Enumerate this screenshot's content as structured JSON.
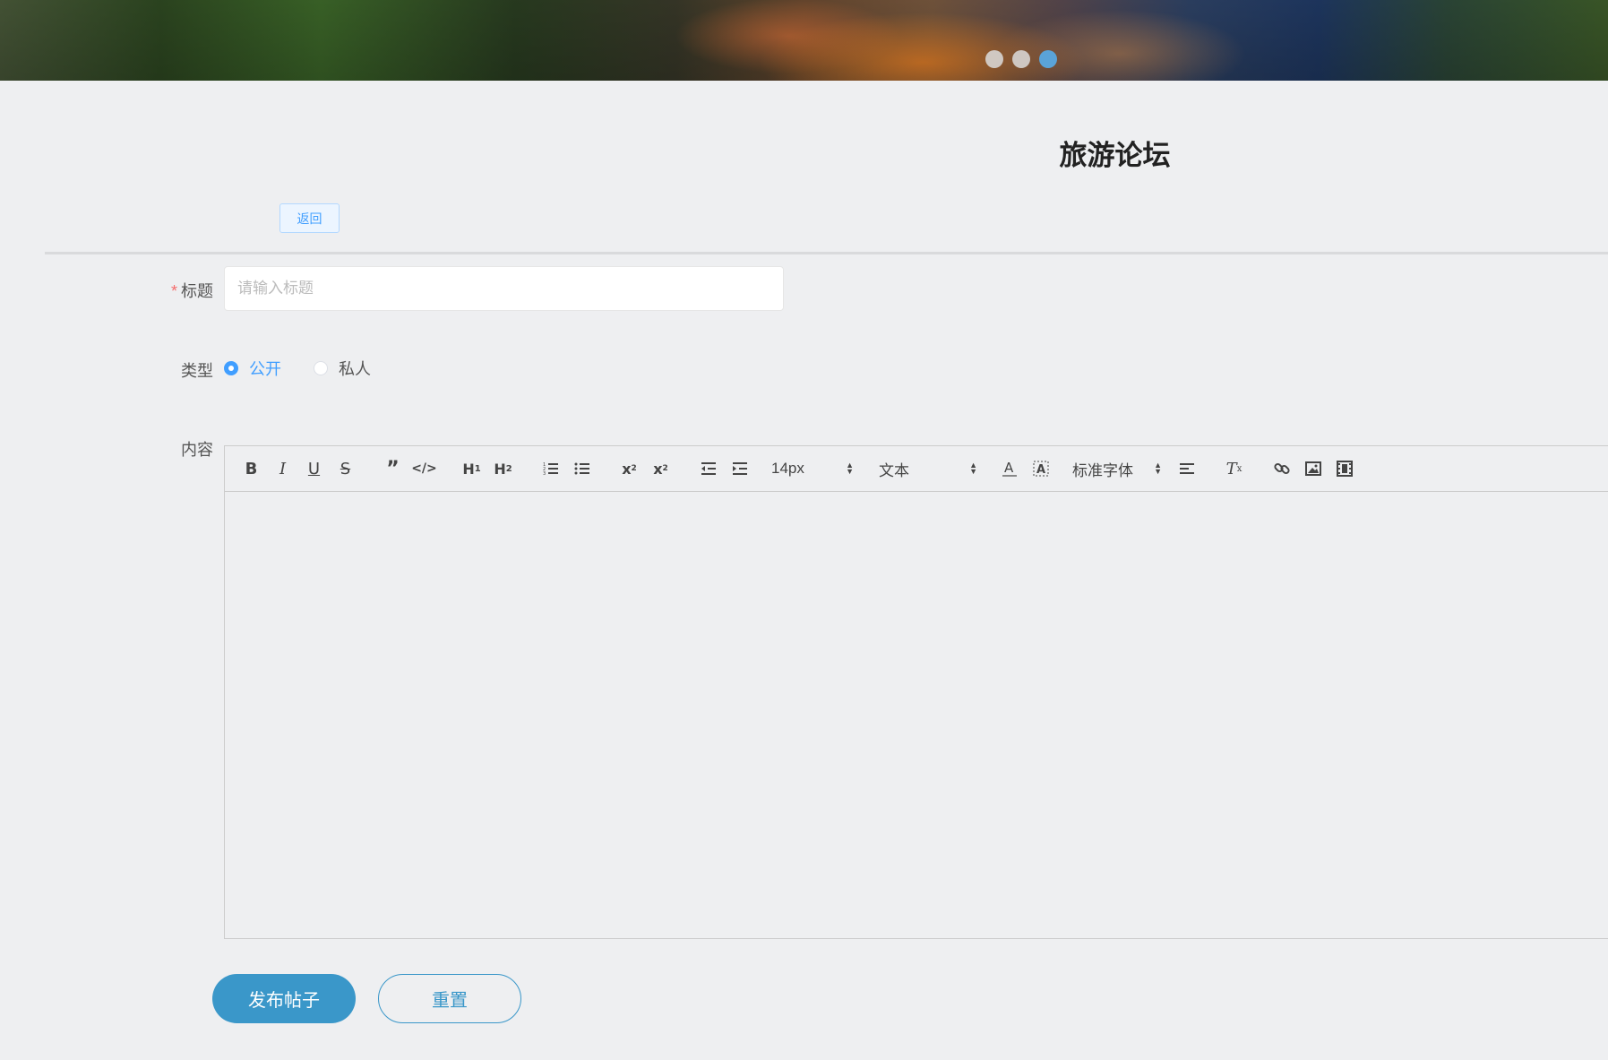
{
  "banner": {
    "carousel_dots": 3,
    "active_dot": 3
  },
  "header": {
    "title": "旅游论坛",
    "back_label": "返回"
  },
  "form": {
    "title_field": {
      "label": "标题",
      "required_mark": "*",
      "placeholder": "请输入标题",
      "value": ""
    },
    "type_field": {
      "label": "类型",
      "options": [
        "公开",
        "私人"
      ],
      "selected": "公开"
    },
    "content_field": {
      "label": "内容",
      "toolbar": {
        "font_size": "14px",
        "header_picker": "文本",
        "font_family": "标准字体"
      },
      "value": ""
    }
  },
  "actions": {
    "submit_label": "发布帖子",
    "reset_label": "重置"
  },
  "colors": {
    "primary": "#3a97c9",
    "accent": "#409eff",
    "required": "#f56c6c",
    "background": "#eeeff1"
  }
}
